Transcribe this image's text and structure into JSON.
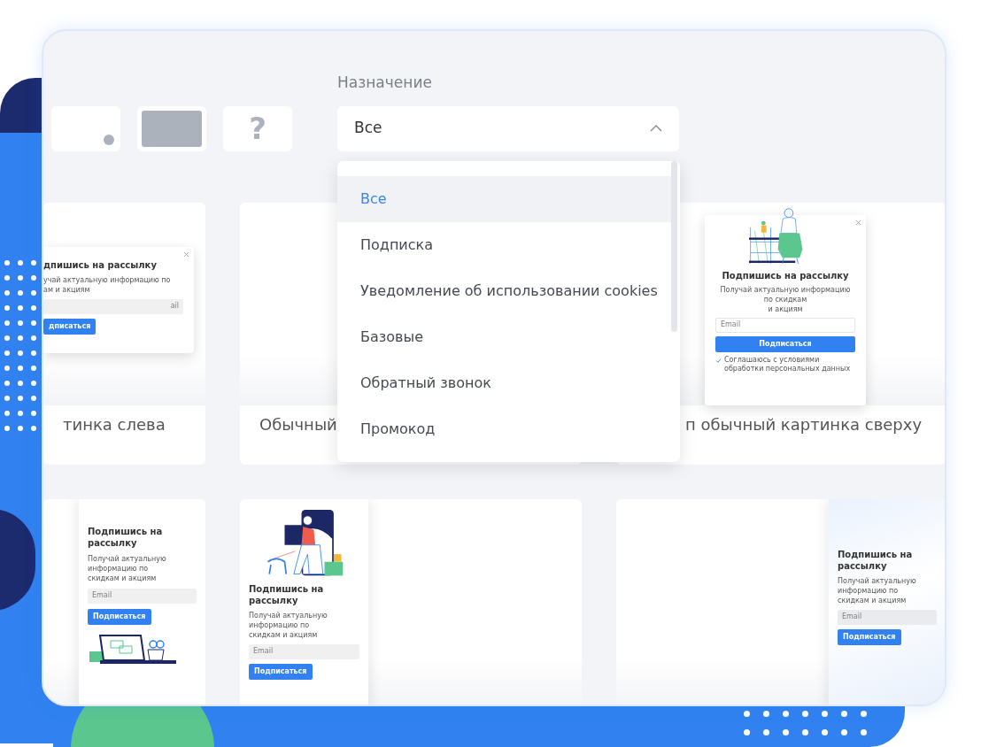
{
  "layout_options": [
    {
      "kind": "dot"
    },
    {
      "kind": "filled"
    },
    {
      "kind": "question",
      "text": "?"
    }
  ],
  "filter": {
    "label": "Назначение",
    "value": "Все",
    "expanded": true
  },
  "dropdown": {
    "options": [
      {
        "label": "Все",
        "selected": true
      },
      {
        "label": "Подписка",
        "selected": false
      },
      {
        "label": "Уведомление об использовании cookies",
        "selected": false
      },
      {
        "label": "Базовые",
        "selected": false
      },
      {
        "label": "Обратный звонок",
        "selected": false
      },
      {
        "label": "Промокод",
        "selected": false
      }
    ]
  },
  "templates": [
    {
      "kind": "popup-left",
      "label": "тинка слева",
      "popup": {
        "title": "дпишись на рассылку",
        "description": [
          "учай актуальную информацию по",
          "ам и акциям"
        ],
        "placeholder": "ail",
        "button": "дписаться"
      }
    },
    {
      "kind": "blank",
      "label": "Обычный"
    },
    {
      "kind": "popup-top-image",
      "label": "п обычный картинка сверху",
      "popup": {
        "title": "Подпишись на рассылку",
        "description": [
          "Получай актуальную информацию по скидкам",
          "и акциям"
        ],
        "placeholder": "Email",
        "button": "Подписаться",
        "consent": {
          "text": "Соглашаюсь с условиями обработки персональных данных",
          "checked": true
        }
      }
    },
    {
      "kind": "panel-bottom-image",
      "popup": {
        "title": "Подпишись на рассылку",
        "description": [
          "Получай актуальную информацию по",
          "скидкам и акциям"
        ],
        "placeholder": "Email",
        "button": "Подписаться"
      }
    },
    {
      "kind": "panel-top-image",
      "popup": {
        "title": "Подпишись на рассылку",
        "description": [
          "Получай актуальную информацию по",
          "скидкам и акциям"
        ],
        "placeholder": "Email",
        "button": "Подписаться"
      }
    },
    {
      "kind": "panel-right",
      "popup": {
        "title": "Подпишись на рассылку",
        "description": [
          "Получай актуальную информацию по",
          "скидкам и акциям"
        ],
        "placeholder": "Email",
        "button": "Подписаться"
      }
    }
  ]
}
